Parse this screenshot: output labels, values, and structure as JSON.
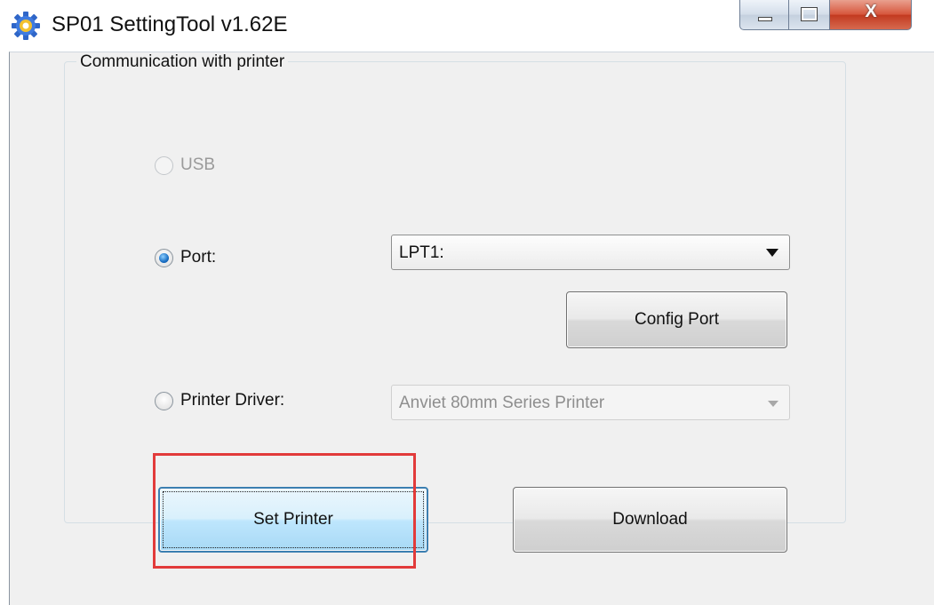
{
  "window": {
    "title": "SP01 SettingTool v1.62E",
    "icon": "gear-icon",
    "controls": {
      "minimize": "minimize-icon",
      "maximize": "maximize-icon",
      "close_glyph": "X"
    }
  },
  "group": {
    "legend": "Communication with printer"
  },
  "options": {
    "usb": {
      "label": "USB",
      "checked": false,
      "enabled": false
    },
    "port": {
      "label": "Port:",
      "checked": true,
      "enabled": true,
      "selected": "LPT1:"
    },
    "printer_driver": {
      "label": "Printer Driver:",
      "checked": false,
      "enabled": true,
      "selected": "Anviet 80mm Series Printer"
    }
  },
  "buttons": {
    "config_port": "Config Port",
    "set_printer": "Set Printer",
    "download": "Download"
  },
  "colors": {
    "highlight": "#e23b3b",
    "focus_border": "#3c7fb1",
    "radio_checked": "#1a6fc4"
  }
}
